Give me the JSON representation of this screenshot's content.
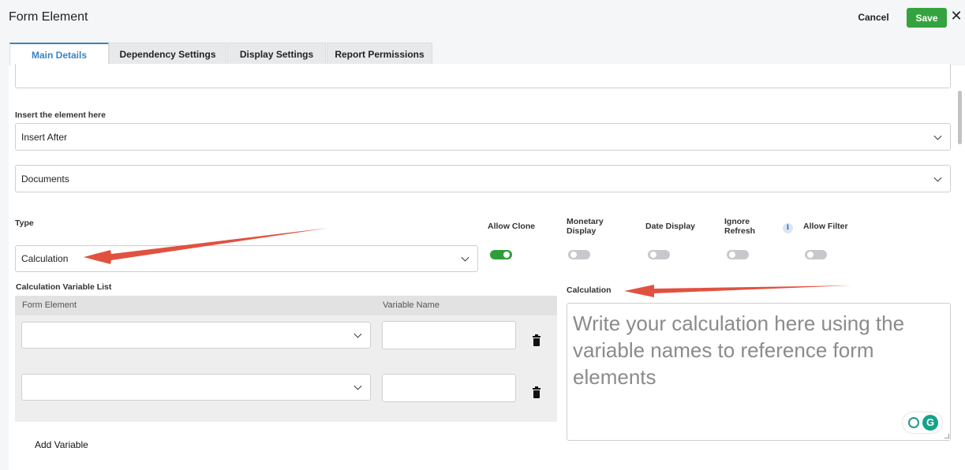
{
  "header": {
    "title": "Form Element",
    "cancel_label": "Cancel",
    "save_label": "Save",
    "close_glyph": "✕"
  },
  "tabs": [
    {
      "label": "Main Details",
      "active": true
    },
    {
      "label": "Dependency Settings",
      "active": false
    },
    {
      "label": "Display Settings",
      "active": false
    },
    {
      "label": "Report Permissions",
      "active": false
    }
  ],
  "main": {
    "insert_label": "Insert the element here",
    "insert_value": "Insert After",
    "documents_value": "Documents",
    "type_label": "Type",
    "type_value": "Calculation",
    "toggles": [
      {
        "label": "Allow Clone",
        "on": true
      },
      {
        "label": "Monetary Display",
        "on": false
      },
      {
        "label": "Date Display",
        "on": false
      },
      {
        "label": "Ignore Refresh",
        "on": false
      },
      {
        "label": "Allow Filter",
        "on": false
      }
    ],
    "info_glyph": "i",
    "variables": {
      "section_label": "Calculation Variable List",
      "col_form_element": "Form Element",
      "col_variable_name": "Variable Name",
      "rows": [
        {
          "form_element": "",
          "variable_name": ""
        },
        {
          "form_element": "",
          "variable_name": ""
        }
      ],
      "add_label": "Add Variable"
    },
    "calculation": {
      "label": "Calculation",
      "placeholder": "Write your calculation here using the variable names to reference form elements"
    },
    "grammarly_glyph": "G"
  },
  "colors": {
    "accent": "#3b82c4",
    "save": "#34a33f",
    "toggle_on": "#2e9e3c",
    "annotation_arrow": "#e0523f"
  },
  "icons": [
    "chevron-down-icon",
    "trash-icon",
    "info-icon",
    "close-icon",
    "grammarly-icon"
  ]
}
